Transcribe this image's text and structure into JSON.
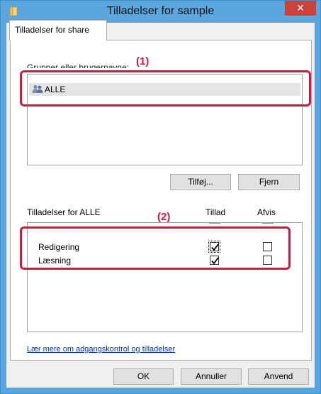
{
  "window": {
    "title": "Tilladelser for sample",
    "close_glyph": "✕"
  },
  "tab": {
    "label": "Tilladelser for share"
  },
  "groups": {
    "label": "Grupper eller brugernavne:",
    "items": [
      {
        "name": "ALLE",
        "icon": "users-icon"
      }
    ],
    "add_button": "Tilføj...",
    "remove_button": "Fjern"
  },
  "permissions": {
    "header": "Tilladelser for ALLE",
    "allow_header": "Tillad",
    "deny_header": "Afvis",
    "rows": [
      {
        "label": "Redigering",
        "allow": true,
        "deny": false
      },
      {
        "label": "Læsning",
        "allow": true,
        "deny": false
      }
    ]
  },
  "help_link": "Lær mere om adgangskontrol og tilladelser",
  "footer": {
    "ok": "OK",
    "cancel": "Annuller",
    "apply": "Anvend"
  },
  "annotations": {
    "one": "(1)",
    "two": "(2)"
  },
  "colors": {
    "accent_red": "#d4183d",
    "titlebar": "#5aa6dd",
    "close": "#c9423b",
    "link": "#0033bb"
  }
}
